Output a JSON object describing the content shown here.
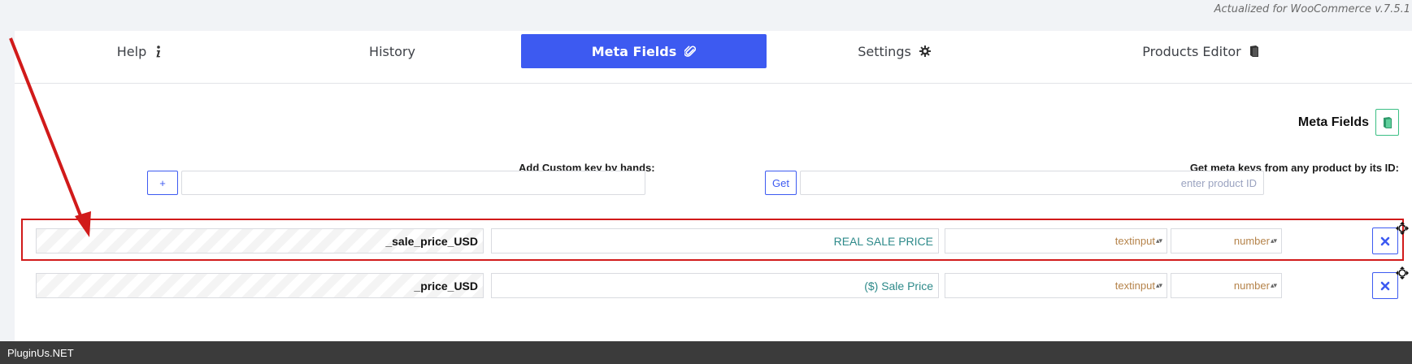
{
  "version_note": "Actualized for WooCommerce v.7.5.1",
  "tabs": [
    {
      "label": "Help",
      "icon": "info-icon",
      "active": false
    },
    {
      "label": "History",
      "icon": "",
      "active": false
    },
    {
      "label": "Meta Fields",
      "icon": "paperclip-icon",
      "active": true
    },
    {
      "label": "Settings",
      "icon": "gear-icon",
      "active": false
    },
    {
      "label": "Products Editor",
      "icon": "book-icon",
      "active": false
    }
  ],
  "colors": {
    "accent": "#3d5af1",
    "highlight_border": "#d11a1a",
    "title_text": "#2e8a8a",
    "type_text": "#b5834a",
    "book_button": "#3bbf84",
    "footer_bg": "#3b3b3b"
  },
  "section_title": "Meta Fields",
  "get_meta": {
    "label": "Get meta keys from any product by its ID:",
    "placeholder": "enter product ID",
    "button": "Get"
  },
  "add_custom": {
    "label": "Add Custom key by hands:",
    "value": "",
    "button": "+"
  },
  "rows": [
    {
      "key": "_sale_price_USD",
      "title": "REAL SALE  PRICE",
      "type": "textinput",
      "field_type": "number",
      "highlighted": true
    },
    {
      "key": "_price_USD",
      "title": "($) Sale Price",
      "type": "textinput",
      "field_type": "number",
      "highlighted": false
    }
  ],
  "footer": "PluginUs.NET"
}
